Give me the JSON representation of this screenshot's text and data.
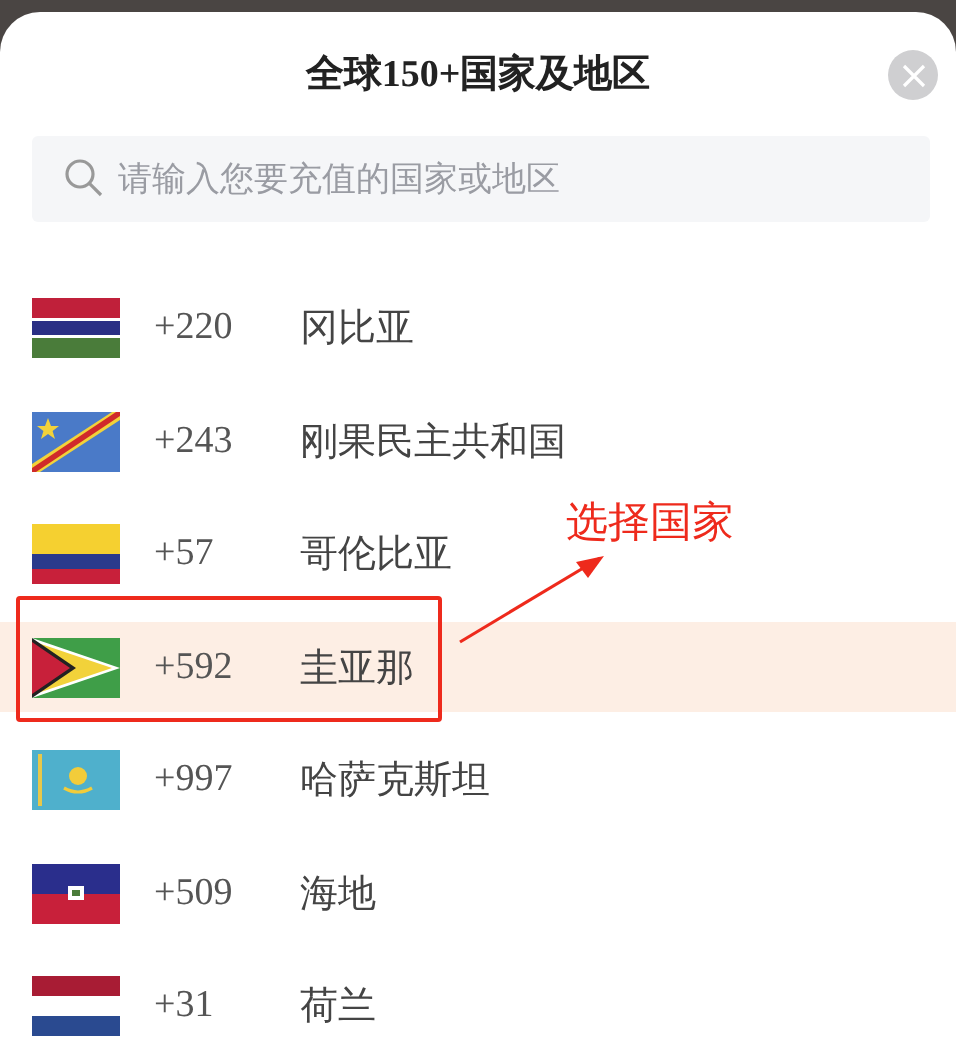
{
  "dialog": {
    "title": "全球150+国家及地区"
  },
  "search": {
    "placeholder": "请输入您要充值的国家或地区"
  },
  "countries": [
    {
      "code": "+220",
      "name": "冈比亚",
      "selected": false
    },
    {
      "code": "+243",
      "name": "刚果民主共和国",
      "selected": false
    },
    {
      "code": "+57",
      "name": "哥伦比亚",
      "selected": false
    },
    {
      "code": "+592",
      "name": "圭亚那",
      "selected": true
    },
    {
      "code": "+997",
      "name": "哈萨克斯坦",
      "selected": false
    },
    {
      "code": "+509",
      "name": "海地",
      "selected": false
    },
    {
      "code": "+31",
      "name": "荷兰",
      "selected": false
    }
  ],
  "annotation": {
    "label": "选择国家"
  }
}
